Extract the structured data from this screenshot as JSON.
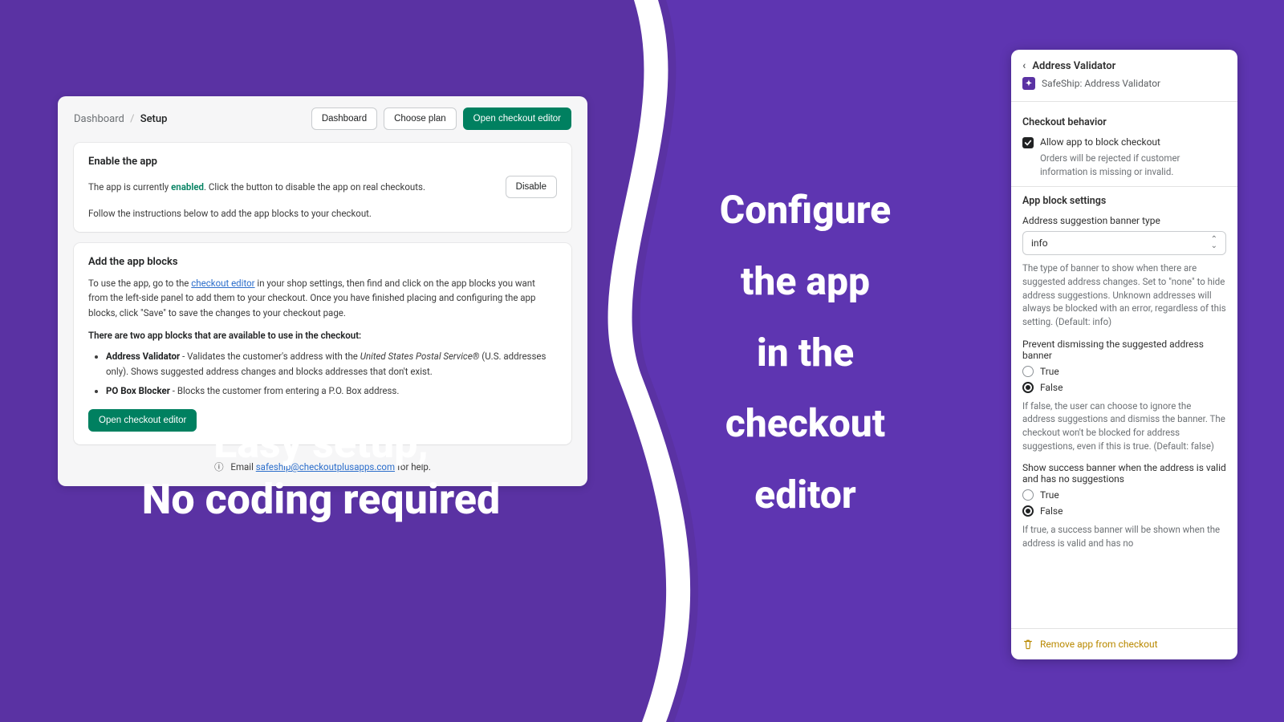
{
  "setup": {
    "breadcrumb_root": "Dashboard",
    "breadcrumb_sep": "/",
    "breadcrumb_current": "Setup",
    "btn_dashboard": "Dashboard",
    "btn_choose_plan": "Choose plan",
    "btn_open_editor": "Open checkout editor",
    "enable": {
      "title": "Enable the app",
      "status_prefix": "The app is currently ",
      "status_word": "enabled",
      "status_suffix": ". Click the button to disable the app on real checkouts.",
      "btn_disable": "Disable",
      "follow": "Follow the instructions below to add the app blocks to your checkout."
    },
    "blocks": {
      "title": "Add the app blocks",
      "desc_prefix": "To use the app, go to the ",
      "desc_link": "checkout editor",
      "desc_suffix": " in your shop settings, then find and click on the app blocks you want from the left-side panel to add them to your checkout. Once you have finished placing and configuring the app blocks, click \"Save\" to save the changes to your checkout page.",
      "subhead": "There are two app blocks that are available to use in the checkout:",
      "item1_name": "Address Validator",
      "item1_desc_prefix": " - Validates the customer's address with the ",
      "item1_desc_italic": "United States Postal Service®",
      "item1_desc_suffix": " (U.S. addresses only). Shows suggested address changes and blocks addresses that don't exist.",
      "item2_name": "PO Box Blocker",
      "item2_desc": " - Blocks the customer from entering a P.O. Box address.",
      "btn_open_editor": "Open checkout editor"
    },
    "footer": {
      "email_prefix": "Email ",
      "email": "safeship@checkoutplusapps.com",
      "email_suffix": " for help."
    }
  },
  "captions": {
    "left_line1": "Easy setup,",
    "left_line2": "No coding required",
    "right_line1": "Configure",
    "right_line2": "the app",
    "right_line3": "in the",
    "right_line4": "checkout",
    "right_line5": "editor"
  },
  "config": {
    "title": "Address Validator",
    "subtitle": "SafeShip: Address Validator",
    "behavior_title": "Checkout behavior",
    "allow_block_label": "Allow app to block checkout",
    "allow_block_help": "Orders will be rejected if customer information is missing or invalid.",
    "settings_title": "App block settings",
    "banner_type_label": "Address suggestion banner type",
    "banner_type_value": "info",
    "banner_type_help": "The type of banner to show when there are suggested address changes. Set to \"none\" to hide address suggestions. Unknown addresses will always be blocked with an error, regardless of this setting. (Default: info)",
    "prevent_label": "Prevent dismissing the suggested address banner",
    "opt_true": "True",
    "opt_false": "False",
    "prevent_help": "If false, the user can choose to ignore the address suggestions and dismiss the banner. The checkout won't be blocked for address suggestions, even if this is true. (Default: false)",
    "success_label": "Show success banner when the address is valid and has no suggestions",
    "success_help": "If true, a success banner will be shown when the address is valid and has no",
    "remove": "Remove app from checkout"
  }
}
